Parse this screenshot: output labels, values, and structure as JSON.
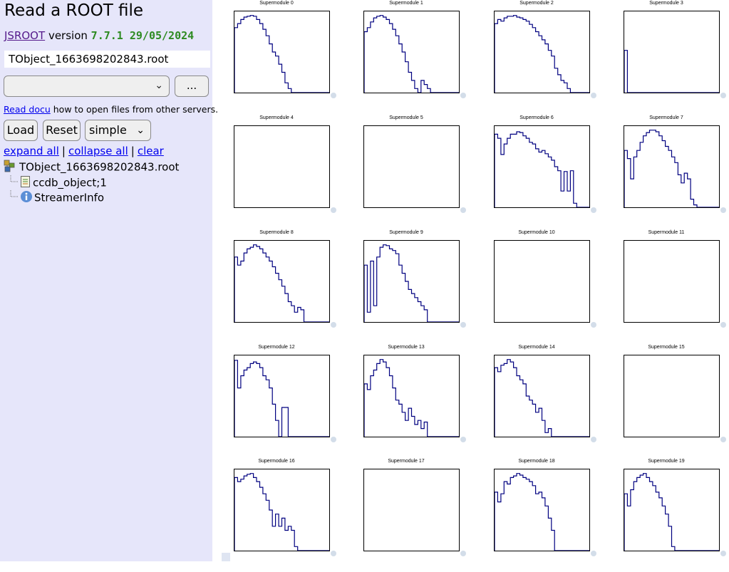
{
  "app": {
    "title": "Read a ROOT file",
    "jsroot_link": "JSROOT",
    "version_word": "version",
    "version_number": "7.7.1 29/05/2024"
  },
  "file_input": {
    "value": "TObject_1663698202843.root"
  },
  "file_select": {
    "selected": ""
  },
  "browse_button": {
    "label": "..."
  },
  "docu": {
    "link": "Read docu",
    "text": "how to open files from other servers."
  },
  "buttons": {
    "load": "Load",
    "reset": "Reset",
    "layout_selected": "simple"
  },
  "tree_controls": {
    "expand": "expand all",
    "collapse": "collapse all",
    "clear": "clear",
    "separator": "|"
  },
  "tree": {
    "root": "TObject_1663698202843.root",
    "items": [
      "ccdb_object;1",
      "StreamerInfo"
    ]
  },
  "colors": {
    "sidebar_bg": "#e6e6fa",
    "histogram_line": "#000080",
    "version": "#2e8b22"
  },
  "pads": [
    {
      "title": "Supermodule 0"
    },
    {
      "title": "Supermodule 1"
    },
    {
      "title": "Supermodule 2"
    },
    {
      "title": "Supermodule 3"
    },
    {
      "title": "Supermodule 4"
    },
    {
      "title": "Supermodule 5"
    },
    {
      "title": "Supermodule 6"
    },
    {
      "title": "Supermodule 7"
    },
    {
      "title": "Supermodule 8"
    },
    {
      "title": "Supermodule 9"
    },
    {
      "title": "Supermodule 10"
    },
    {
      "title": "Supermodule 11"
    },
    {
      "title": "Supermodule 12"
    },
    {
      "title": "Supermodule 13"
    },
    {
      "title": "Supermodule 14"
    },
    {
      "title": "Supermodule 15"
    },
    {
      "title": "Supermodule 16"
    },
    {
      "title": "Supermodule 17"
    },
    {
      "title": "Supermodule 18"
    },
    {
      "title": "Supermodule 19"
    }
  ],
  "chart_data": [
    {
      "type": "line",
      "title": "Supermodule 0",
      "values": [
        0.8,
        0.85,
        0.9,
        0.93,
        0.94,
        0.95,
        0.94,
        0.9,
        0.85,
        0.78,
        0.7,
        0.6,
        0.5,
        0.45,
        0.35,
        0.25,
        0.12,
        0.05,
        0,
        0,
        0,
        0,
        0,
        0,
        0,
        0,
        0,
        0,
        0,
        0
      ]
    },
    {
      "type": "line",
      "title": "Supermodule 1",
      "values": [
        0.75,
        0.8,
        0.87,
        0.92,
        0.94,
        0.95,
        0.93,
        0.9,
        0.85,
        0.78,
        0.7,
        0.6,
        0.5,
        0.38,
        0.25,
        0.15,
        0.05,
        0,
        0.15,
        0.1,
        0.05,
        0,
        0,
        0,
        0,
        0,
        0,
        0,
        0,
        0
      ]
    },
    {
      "type": "line",
      "title": "Supermodule 2",
      "values": [
        0.85,
        0.9,
        0.88,
        0.92,
        0.94,
        0.94,
        0.95,
        0.93,
        0.92,
        0.9,
        0.88,
        0.84,
        0.8,
        0.75,
        0.7,
        0.65,
        0.6,
        0.52,
        0.45,
        0.3,
        0.22,
        0.15,
        0.12,
        0.05,
        0,
        0,
        0,
        0,
        0,
        0
      ]
    },
    {
      "type": "line",
      "title": "Supermodule 3",
      "values": [
        0.52,
        0,
        0,
        0,
        0,
        0,
        0,
        0,
        0,
        0,
        0,
        0,
        0,
        0,
        0,
        0,
        0,
        0,
        0,
        0,
        0,
        0,
        0,
        0,
        0,
        0,
        0,
        0,
        0,
        0
      ]
    },
    {
      "type": "line",
      "title": "Supermodule 4",
      "values": []
    },
    {
      "type": "line",
      "title": "Supermodule 5",
      "values": []
    },
    {
      "type": "line",
      "title": "Supermodule 6",
      "values": [
        0.9,
        0.85,
        0.65,
        0.78,
        0.85,
        0.9,
        0.9,
        0.93,
        0.92,
        0.88,
        0.85,
        0.8,
        0.78,
        0.72,
        0.68,
        0.7,
        0.66,
        0.62,
        0.58,
        0.5,
        0.45,
        0.2,
        0.44,
        0.2,
        0.45,
        0.05,
        0,
        0,
        0,
        0
      ]
    },
    {
      "type": "line",
      "title": "Supermodule 7",
      "values": [
        0.7,
        0.6,
        0.35,
        0.62,
        0.7,
        0.8,
        0.88,
        0.92,
        0.95,
        0.95,
        0.93,
        0.88,
        0.82,
        0.75,
        0.7,
        0.62,
        0.55,
        0.4,
        0.3,
        0.42,
        0.35,
        0.1,
        0.03,
        0,
        0,
        0,
        0,
        0,
        0,
        0
      ]
    },
    {
      "type": "line",
      "title": "Supermodule 8",
      "values": [
        0.8,
        0.7,
        0.75,
        0.85,
        0.9,
        0.92,
        0.95,
        0.93,
        0.9,
        0.85,
        0.8,
        0.75,
        0.68,
        0.6,
        0.52,
        0.44,
        0.35,
        0.25,
        0.2,
        0.12,
        0.18,
        0.15,
        0,
        0,
        0,
        0,
        0,
        0,
        0,
        0
      ]
    },
    {
      "type": "line",
      "title": "Supermodule 9",
      "values": [
        0.7,
        0.12,
        0.75,
        0.2,
        0.8,
        0.92,
        0.95,
        0.94,
        0.9,
        0.88,
        0.84,
        0.7,
        0.6,
        0.5,
        0.4,
        0.35,
        0.3,
        0.25,
        0.2,
        0.15,
        0,
        0,
        0,
        0,
        0,
        0,
        0,
        0,
        0,
        0
      ]
    },
    {
      "type": "line",
      "title": "Supermodule 10",
      "values": []
    },
    {
      "type": "line",
      "title": "Supermodule 11",
      "values": []
    },
    {
      "type": "line",
      "title": "Supermodule 12",
      "values": [
        0.94,
        0.6,
        0.75,
        0.82,
        0.85,
        0.9,
        0.92,
        0.9,
        0.85,
        0.75,
        0.7,
        0.6,
        0.4,
        0.2,
        0,
        0.36,
        0.36,
        0,
        0,
        0,
        0,
        0,
        0,
        0,
        0,
        0,
        0,
        0,
        0,
        0
      ]
    },
    {
      "type": "line",
      "title": "Supermodule 13",
      "values": [
        0.65,
        0.58,
        0.75,
        0.82,
        0.9,
        0.95,
        0.92,
        0.85,
        0.75,
        0.6,
        0.45,
        0.4,
        0.3,
        0.2,
        0.35,
        0.25,
        0.15,
        0.2,
        0.1,
        0.18,
        0,
        0,
        0,
        0,
        0,
        0,
        0,
        0,
        0,
        0
      ]
    },
    {
      "type": "line",
      "title": "Supermodule 14",
      "values": [
        0.85,
        0.8,
        0.88,
        0.9,
        0.95,
        0.92,
        0.85,
        0.75,
        0.7,
        0.65,
        0.5,
        0.45,
        0.4,
        0.3,
        0.35,
        0.2,
        0.05,
        0.1,
        0,
        0,
        0,
        0,
        0,
        0,
        0,
        0,
        0,
        0,
        0,
        0
      ]
    },
    {
      "type": "line",
      "title": "Supermodule 15",
      "values": []
    },
    {
      "type": "line",
      "title": "Supermodule 16",
      "values": [
        0.9,
        0.85,
        0.88,
        0.92,
        0.94,
        0.95,
        0.9,
        0.85,
        0.78,
        0.7,
        0.62,
        0.5,
        0.3,
        0.45,
        0.3,
        0.4,
        0.25,
        0.3,
        0.25,
        0.05,
        0,
        0,
        0,
        0,
        0,
        0,
        0,
        0,
        0,
        0
      ]
    },
    {
      "type": "line",
      "title": "Supermodule 17",
      "values": []
    },
    {
      "type": "line",
      "title": "Supermodule 18",
      "values": [
        0.72,
        0.6,
        0.7,
        0.85,
        0.82,
        0.9,
        0.92,
        0.95,
        0.93,
        0.9,
        0.88,
        0.85,
        0.8,
        0.7,
        0.72,
        0.65,
        0.55,
        0.4,
        0.25,
        0,
        0,
        0,
        0,
        0,
        0,
        0,
        0,
        0,
        0,
        0
      ]
    },
    {
      "type": "line",
      "title": "Supermodule 19",
      "values": [
        0.7,
        0.55,
        0.75,
        0.85,
        0.9,
        0.93,
        0.95,
        0.9,
        0.85,
        0.8,
        0.72,
        0.65,
        0.55,
        0.45,
        0.3,
        0.05,
        0,
        0,
        0,
        0,
        0,
        0,
        0,
        0,
        0,
        0,
        0,
        0,
        0,
        0
      ]
    }
  ]
}
